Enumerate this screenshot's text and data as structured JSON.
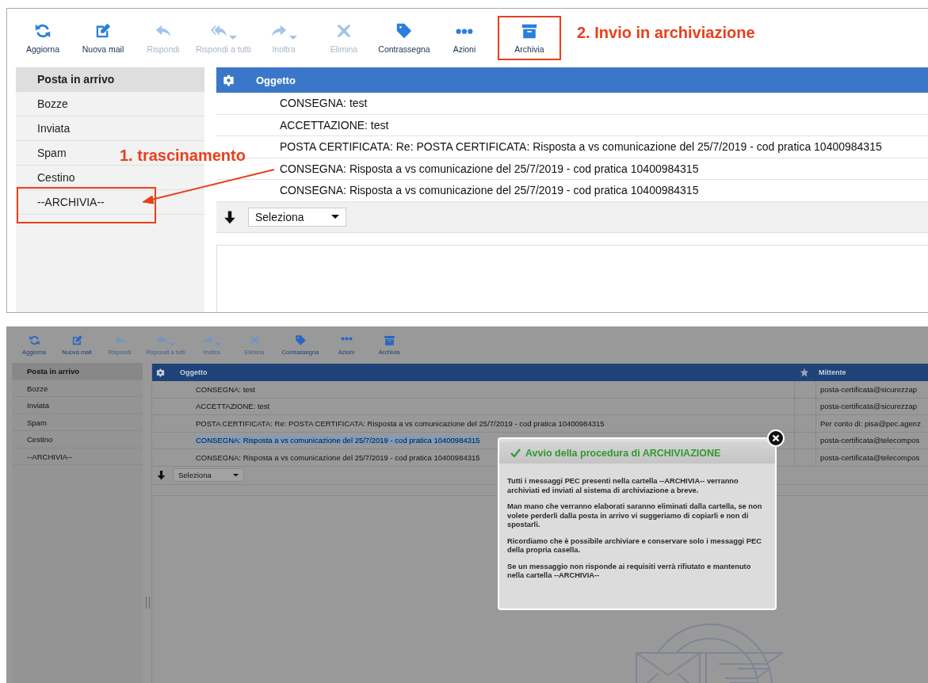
{
  "top_screen": {
    "toolbar": [
      {
        "label": "Aggiorna",
        "disabled": false,
        "menu": false,
        "highlighted": false
      },
      {
        "label": "Nuova mail",
        "disabled": false,
        "menu": false,
        "highlighted": false
      },
      {
        "label": "Rispondi",
        "disabled": true,
        "menu": false,
        "highlighted": false
      },
      {
        "label": "Rispondi a tutti",
        "disabled": true,
        "menu": true,
        "highlighted": false
      },
      {
        "label": "Inoltra",
        "disabled": true,
        "menu": true,
        "highlighted": false
      },
      {
        "label": "Elimina",
        "disabled": true,
        "menu": false,
        "highlighted": false
      },
      {
        "label": "Contrassegna",
        "disabled": false,
        "menu": false,
        "highlighted": false
      },
      {
        "label": "Azioni",
        "disabled": false,
        "menu": false,
        "highlighted": false
      },
      {
        "label": "Archivia",
        "disabled": false,
        "menu": false,
        "highlighted": true
      }
    ],
    "toolbar_callout": "2. Invio in archiviazione",
    "folders": [
      {
        "label": "Posta in arrivo",
        "selected": true,
        "highlighted": false
      },
      {
        "label": "Bozze",
        "selected": false,
        "highlighted": false
      },
      {
        "label": "Inviata",
        "selected": false,
        "highlighted": false
      },
      {
        "label": "Spam",
        "selected": false,
        "highlighted": false
      },
      {
        "label": "Cestino",
        "selected": false,
        "highlighted": false
      },
      {
        "label": "--ARCHIVIA--",
        "selected": false,
        "highlighted": true
      }
    ],
    "drag_callout": "1. trascinamento",
    "table": {
      "columns": [
        "Oggetto"
      ],
      "rows": [
        {
          "subject": "CONSEGNA: test"
        },
        {
          "subject": "ACCETTAZIONE: test"
        },
        {
          "subject": "POSTA CERTIFICATA: Re: POSTA CERTIFICATA: Risposta a vs comunicazione del 25/7/2019 - cod pratica 10400984315"
        },
        {
          "subject": "CONSEGNA: Risposta a vs comunicazione del 25/7/2019 - cod pratica 10400984315"
        },
        {
          "subject": "CONSEGNA: Risposta a vs comunicazione del 25/7/2019 - cod pratica 10400984315"
        }
      ]
    },
    "select": "Seleziona"
  },
  "bottom_screen": {
    "toolbar": [
      {
        "label": "Aggiorna",
        "disabled": false,
        "menu": false
      },
      {
        "label": "Nuova mail",
        "disabled": false,
        "menu": false
      },
      {
        "label": "Rispondi",
        "disabled": true,
        "menu": false
      },
      {
        "label": "Rispondi a tutti",
        "disabled": true,
        "menu": true
      },
      {
        "label": "Inoltra",
        "disabled": true,
        "menu": true
      },
      {
        "label": "Elimina",
        "disabled": true,
        "menu": false
      },
      {
        "label": "Contrassegna",
        "disabled": false,
        "menu": false
      },
      {
        "label": "Azioni",
        "disabled": false,
        "menu": false
      },
      {
        "label": "Archivia",
        "disabled": false,
        "menu": false
      }
    ],
    "folders": [
      {
        "label": "Posta in arrivo",
        "selected": true
      },
      {
        "label": "Bozze",
        "selected": false
      },
      {
        "label": "Inviata",
        "selected": false
      },
      {
        "label": "Spam",
        "selected": false
      },
      {
        "label": "Cestino",
        "selected": false
      },
      {
        "label": "--ARCHIVIA--",
        "selected": false
      }
    ],
    "table": {
      "columns": [
        "Oggetto",
        "Mittente"
      ],
      "rows": [
        {
          "subject": "CONSEGNA: test",
          "sender": "posta-certificata@sicurezzap",
          "selected": false
        },
        {
          "subject": "ACCETTAZIONE: test",
          "sender": "posta-certificata@sicurezzap",
          "selected": false
        },
        {
          "subject": "POSTA CERTIFICATA: Re: POSTA CERTIFICATA: Risposta a vs comunicazione del 25/7/2019 - cod pratica 10400984315",
          "sender": "Per conto di: pisa@pec.agenz",
          "selected": false
        },
        {
          "subject": "CONSEGNA: Risposta a vs comunicazione del 25/7/2019 - cod pratica 10400984315",
          "sender": "posta-certificata@telecompos",
          "selected": true
        },
        {
          "subject": "CONSEGNA: Risposta a vs comunicazione del 25/7/2019 - cod pratica 10400984315",
          "sender": "posta-certificata@telecompos",
          "selected": false
        }
      ]
    },
    "select": "Seleziona",
    "dialog": {
      "title": "Avvio della procedura di ARCHIVIAZIONE",
      "paragraphs": [
        "Tutti i messaggi PEC presenti nella cartella --ARCHIVIA-- verranno archiviati ed inviati al sistema di archiviazione a breve.",
        "Man mano che verranno elaborati saranno eliminati dalla cartella, se non volete perderli dalla posta in arrivo vi suggeriamo di copiarli e non di spostarli.",
        "Ricordiamo che è possibile archiviare e conservare solo i messaggi PEC della propria casella.",
        "Se un messaggio non risponde ai requisiti verrà rifiutato e mantenuto nella cartella --ARCHIVIA--"
      ]
    }
  }
}
